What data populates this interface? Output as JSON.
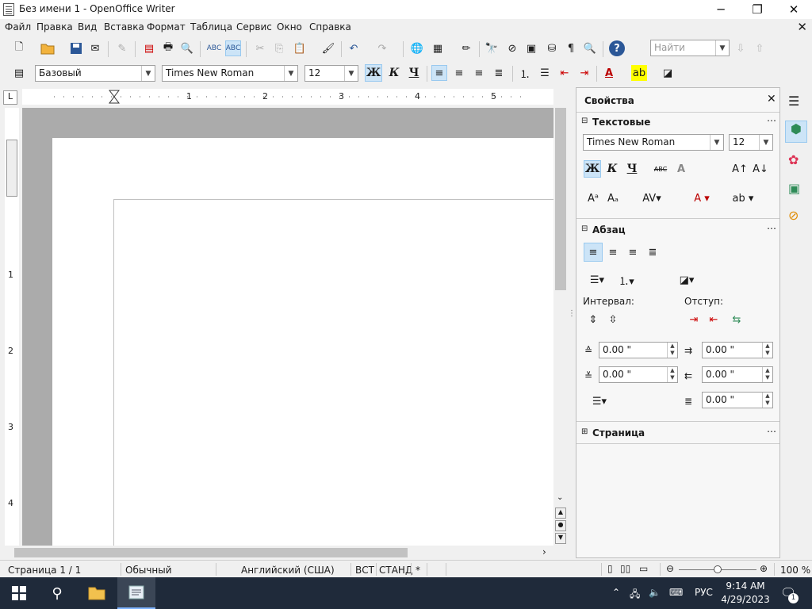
{
  "window": {
    "title": "Без имени 1 - OpenOffice Writer",
    "controls": {
      "minimize": "─",
      "maximize": "❐",
      "close": "✕"
    }
  },
  "menu": {
    "items": [
      "Файл",
      "Правка",
      "Вид",
      "Вставка",
      "Формат",
      "Таблица",
      "Сервис",
      "Окно",
      "Справка"
    ],
    "close_doc": "✕"
  },
  "toolbar": {
    "find_placeholder": "Найти"
  },
  "formatting": {
    "style": "Базовый",
    "font": "Times New Roman",
    "size": "12",
    "bold": "Ж",
    "italic": "К",
    "underline": "Ч"
  },
  "ruler": {
    "h_marks": [
      "1",
      "2",
      "3",
      "4",
      "5"
    ],
    "v_marks": [
      "1",
      "2",
      "3",
      "4"
    ],
    "corner": "L"
  },
  "sidebar": {
    "title": "Свойства",
    "text_section": "Текстовые",
    "font": "Times New Roman",
    "size": "12",
    "bold": "Ж",
    "italic": "К",
    "underline": "Ч",
    "paragraph_section": "Абзац",
    "spacing_label": "Интервал:",
    "indent_label": "Отступ:",
    "spacing_above": "0.00 \"",
    "spacing_below": "0.00 \"",
    "indent_before": "0.00 \"",
    "indent_after": "0.00 \"",
    "first_line": "0.00 \"",
    "page_section": "Страница"
  },
  "status": {
    "page": "Страница   1 / 1",
    "style": "Обычный",
    "language": "Английский (США)",
    "insert": "ВСТ",
    "select": "СТАНД",
    "modified": "*",
    "zoom": "100 %",
    "zoom_level": 0.5
  },
  "taskbar": {
    "language": "РУС",
    "time": "9:14 AM",
    "date": "4/29/2023",
    "notification_count": "1"
  }
}
